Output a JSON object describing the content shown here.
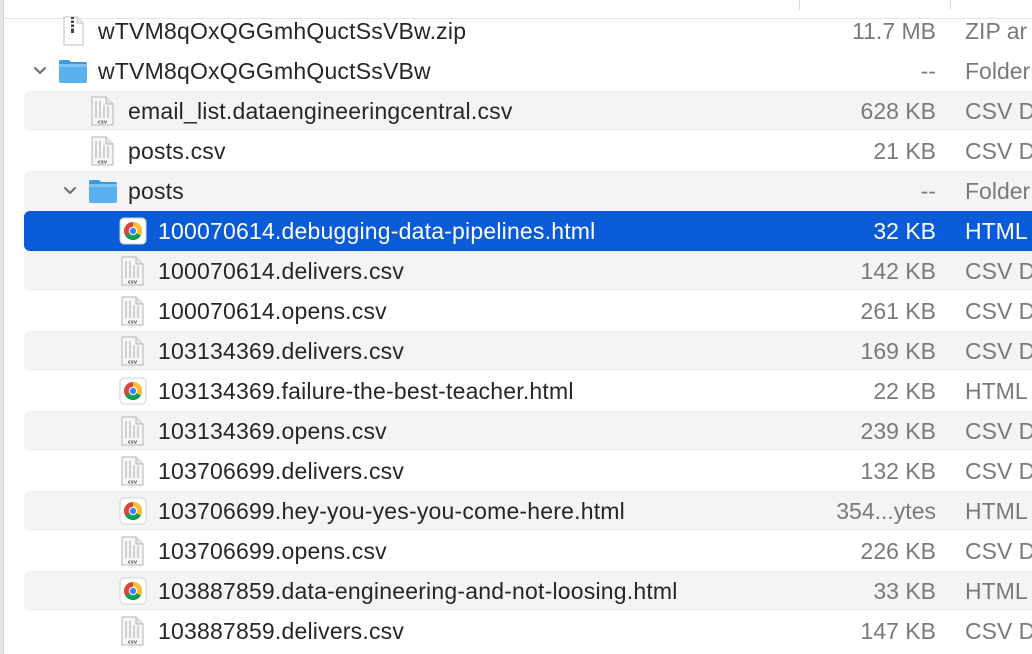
{
  "rows": [
    {
      "name": "wTVM8qOxQGGmhQuctSsVBw.zip",
      "size": "11.7 MB",
      "kind": "ZIP ar",
      "icon": "zip-file-icon",
      "level": 1,
      "alt": false,
      "selected": false,
      "disclosure": ""
    },
    {
      "name": "wTVM8qOxQGGmhQuctSsVBw",
      "size": "--",
      "kind": "Folder",
      "icon": "folder-icon",
      "level": 1,
      "alt": false,
      "selected": false,
      "disclosure": "expanded"
    },
    {
      "name": "email_list.dataengineeringcentral.csv",
      "size": "628 KB",
      "kind": "CSV D",
      "icon": "csv-file-icon",
      "level": 2,
      "alt": true,
      "selected": false,
      "disclosure": ""
    },
    {
      "name": "posts.csv",
      "size": "21 KB",
      "kind": "CSV D",
      "icon": "csv-file-icon",
      "level": 2,
      "alt": false,
      "selected": false,
      "disclosure": ""
    },
    {
      "name": "posts",
      "size": "--",
      "kind": "Folder",
      "icon": "folder-icon",
      "level": 2,
      "alt": true,
      "selected": false,
      "disclosure": "expanded"
    },
    {
      "name": "100070614.debugging-data-pipelines.html",
      "size": "32 KB",
      "kind": "HTML",
      "icon": "chrome-html-icon",
      "level": 3,
      "alt": false,
      "selected": true,
      "disclosure": ""
    },
    {
      "name": "100070614.delivers.csv",
      "size": "142 KB",
      "kind": "CSV D",
      "icon": "csv-file-icon",
      "level": 3,
      "alt": true,
      "selected": false,
      "disclosure": ""
    },
    {
      "name": "100070614.opens.csv",
      "size": "261 KB",
      "kind": "CSV D",
      "icon": "csv-file-icon",
      "level": 3,
      "alt": false,
      "selected": false,
      "disclosure": ""
    },
    {
      "name": "103134369.delivers.csv",
      "size": "169 KB",
      "kind": "CSV D",
      "icon": "csv-file-icon",
      "level": 3,
      "alt": true,
      "selected": false,
      "disclosure": ""
    },
    {
      "name": "103134369.failure-the-best-teacher.html",
      "size": "22 KB",
      "kind": "HTML",
      "icon": "chrome-html-icon",
      "level": 3,
      "alt": false,
      "selected": false,
      "disclosure": ""
    },
    {
      "name": "103134369.opens.csv",
      "size": "239 KB",
      "kind": "CSV D",
      "icon": "csv-file-icon",
      "level": 3,
      "alt": true,
      "selected": false,
      "disclosure": ""
    },
    {
      "name": "103706699.delivers.csv",
      "size": "132 KB",
      "kind": "CSV D",
      "icon": "csv-file-icon",
      "level": 3,
      "alt": false,
      "selected": false,
      "disclosure": ""
    },
    {
      "name": "103706699.hey-you-yes-you-come-here.html",
      "size": "354...ytes",
      "kind": "HTML",
      "icon": "chrome-html-icon",
      "level": 3,
      "alt": true,
      "selected": false,
      "disclosure": ""
    },
    {
      "name": "103706699.opens.csv",
      "size": "226 KB",
      "kind": "CSV D",
      "icon": "csv-file-icon",
      "level": 3,
      "alt": false,
      "selected": false,
      "disclosure": ""
    },
    {
      "name": "103887859.data-engineering-and-not-loosing.html",
      "size": "33 KB",
      "kind": "HTML",
      "icon": "chrome-html-icon",
      "level": 3,
      "alt": true,
      "selected": false,
      "disclosure": ""
    },
    {
      "name": "103887859.delivers.csv",
      "size": "147 KB",
      "kind": "CSV D",
      "icon": "csv-file-icon",
      "level": 3,
      "alt": false,
      "selected": false,
      "disclosure": ""
    }
  ],
  "colors": {
    "selection": "#0a5bd8",
    "folder": "#4aa6ec",
    "alt_row": "#f4f4f5"
  }
}
